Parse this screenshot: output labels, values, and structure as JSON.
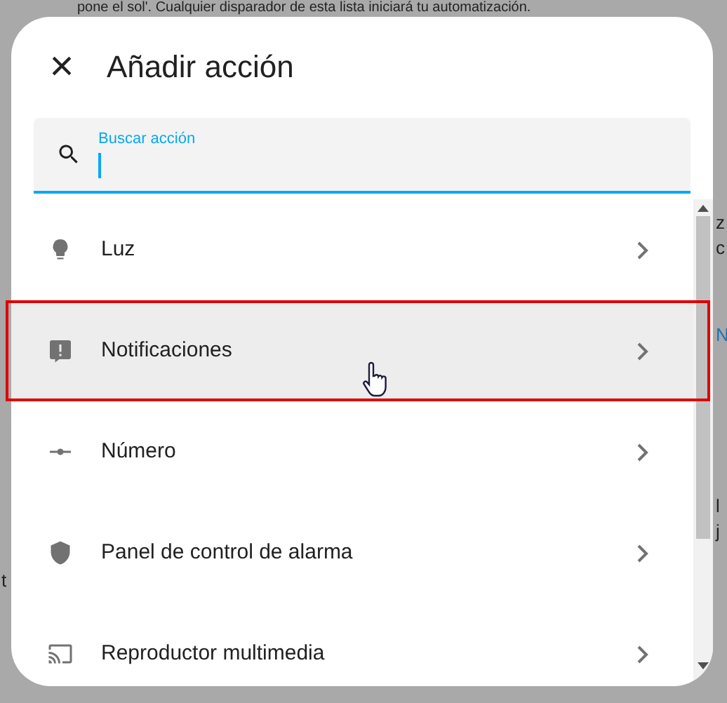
{
  "background_page": {
    "top_text": "pone el sol'. Cualquier disparador de esta lista iniciará tu automatización.",
    "right_fragments": [
      {
        "text": "z",
        "kind": "plain"
      },
      {
        "text": "c",
        "kind": "plain"
      },
      {
        "text": "N",
        "kind": "link"
      },
      {
        "text": "l",
        "kind": "plain"
      },
      {
        "text": "j",
        "kind": "plain"
      }
    ],
    "left_fragment": "t"
  },
  "dialog": {
    "close": "×",
    "title": "Añadir acción",
    "search": {
      "label": "Buscar acción"
    },
    "items": [
      {
        "label": "Luz",
        "highlighted": false
      },
      {
        "label": "Notificaciones",
        "highlighted": true
      },
      {
        "label": "Número",
        "highlighted": false
      },
      {
        "label": "Panel de control de alarma",
        "highlighted": false
      },
      {
        "label": "Reproductor multimedia",
        "highlighted": false
      }
    ]
  }
}
